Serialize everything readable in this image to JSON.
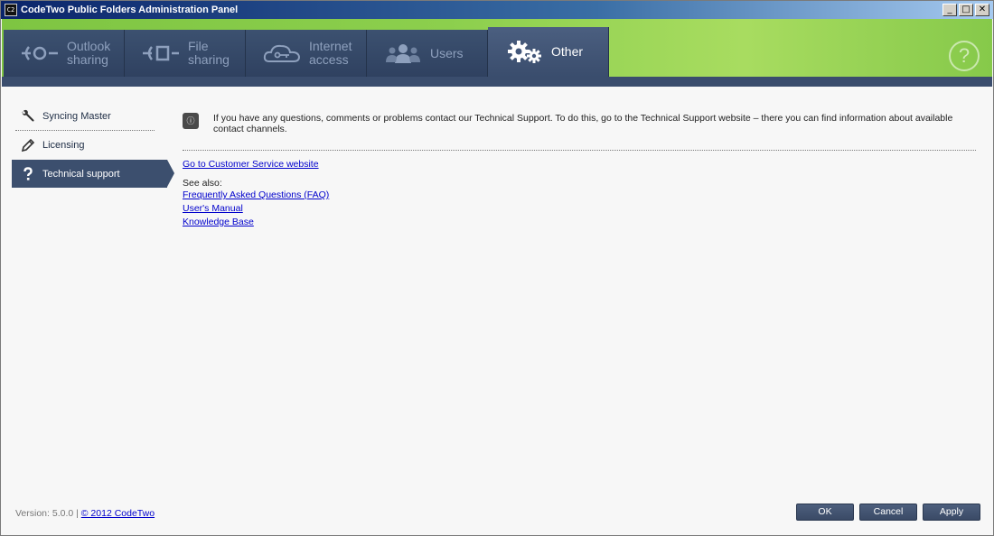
{
  "window": {
    "title": "CodeTwo Public Folders Administration Panel",
    "app_icon_text": "C2",
    "minimize": "_",
    "maximize": "□",
    "close": "✕"
  },
  "ribbon": {
    "tabs": [
      {
        "label": "Outlook\nsharing",
        "icon": "outlook-sharing-icon",
        "active": false
      },
      {
        "label": "File\nsharing",
        "icon": "file-sharing-icon",
        "active": false
      },
      {
        "label": "Internet\naccess",
        "icon": "cloud-key-icon",
        "active": false
      },
      {
        "label": "Users",
        "icon": "users-icon",
        "active": false
      },
      {
        "label": "Other",
        "icon": "gears-icon",
        "active": true
      }
    ],
    "help_label": "?"
  },
  "sidebar": {
    "items": [
      {
        "label": "Syncing Master",
        "icon": "wrench-icon"
      },
      {
        "label": "Licensing",
        "icon": "pencil-icon"
      },
      {
        "label": "Technical support",
        "icon": "question-icon",
        "active": true
      }
    ]
  },
  "content": {
    "info_icon": "ⓘ",
    "info_text": "If you have any questions, comments or problems contact our Technical Support. To do this, go to the Technical Support website – there you can find information about available contact channels.",
    "main_link": "Go to Customer Service website",
    "see_also": "See also:",
    "links": [
      "Frequently Asked Questions (FAQ)",
      "User's Manual",
      "Knowledge Base"
    ]
  },
  "footer": {
    "version": "Version: 5.0.0 |",
    "copyright": "© 2012 CodeTwo",
    "buttons": {
      "ok": "OK",
      "cancel": "Cancel",
      "apply": "Apply"
    }
  },
  "colors": {
    "ribbon_green": "#8ccf4d",
    "ribbon_dark": "#2e3f57",
    "active_item": "#3c4f6e",
    "link": "#0000cc"
  }
}
